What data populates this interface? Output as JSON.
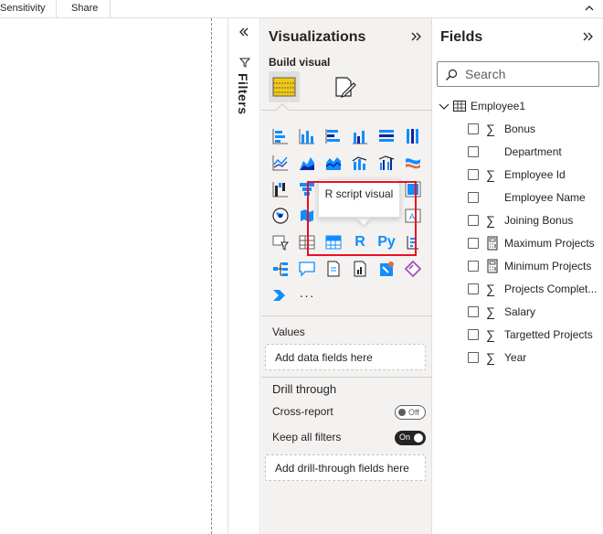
{
  "ribbon": {
    "tabs": [
      "Sensitivity",
      "Share"
    ]
  },
  "filters": {
    "label": "Filters"
  },
  "visualizations": {
    "title": "Visualizations",
    "build_visual_label": "Build visual",
    "tooltip": "R script visual",
    "r_label": "R",
    "py_label": "Py",
    "more": "···",
    "values_label": "Values",
    "values_placeholder": "Add data fields here",
    "drill_through_label": "Drill through",
    "cross_report_label": "Cross-report",
    "cross_report_state": "Off",
    "keep_filters_label": "Keep all filters",
    "keep_filters_state": "On",
    "drill_placeholder": "Add drill-through fields here"
  },
  "fields": {
    "title": "Fields",
    "search_placeholder": "Search",
    "table_name": "Employee1",
    "items": [
      {
        "label": "Bonus",
        "icon": "sigma-icon"
      },
      {
        "label": "Department",
        "icon": "none"
      },
      {
        "label": "Employee Id",
        "icon": "sigma-icon"
      },
      {
        "label": "Employee Name",
        "icon": "none"
      },
      {
        "label": "Joining Bonus",
        "icon": "sigma-icon"
      },
      {
        "label": "Maximum Projects",
        "icon": "calculator-icon"
      },
      {
        "label": "Minimum Projects",
        "icon": "calculator-icon"
      },
      {
        "label": "Projects Complet...",
        "icon": "sigma-icon"
      },
      {
        "label": "Salary",
        "icon": "sigma-icon"
      },
      {
        "label": "Targetted Projects",
        "icon": "sigma-icon"
      },
      {
        "label": "Year",
        "icon": "sigma-icon"
      }
    ]
  },
  "colors": {
    "accent_blue": "#118dff",
    "highlight_red": "#e81123",
    "build_yellow": "#f2c811"
  }
}
